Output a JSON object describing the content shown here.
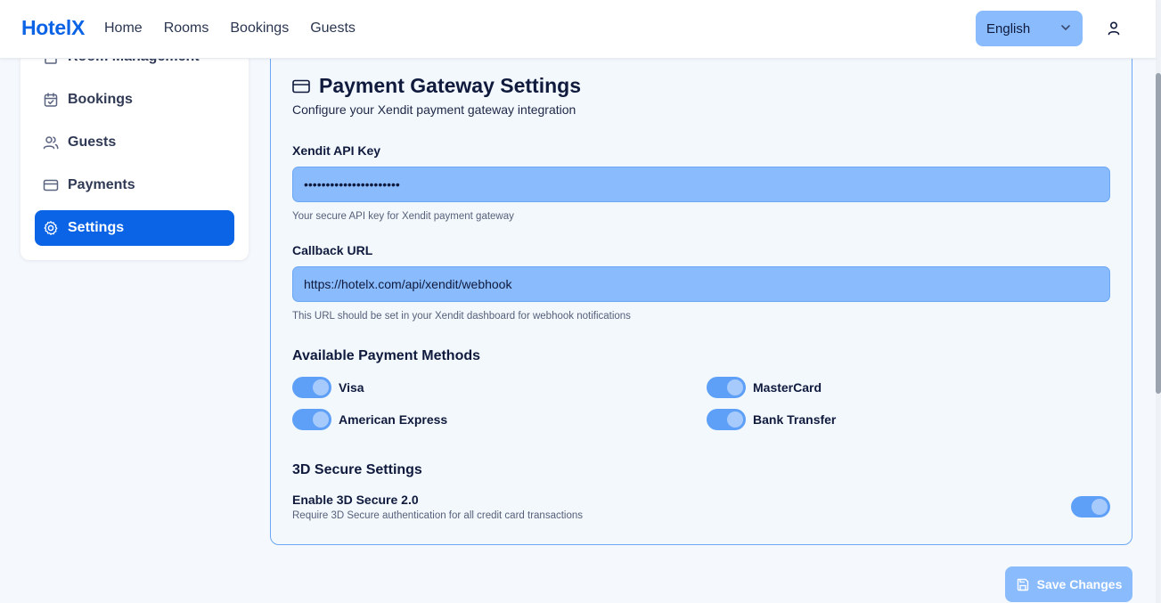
{
  "header": {
    "brand": "HotelX",
    "nav": [
      "Home",
      "Rooms",
      "Bookings",
      "Guests"
    ],
    "language": "English",
    "user_icon": "user-icon"
  },
  "sidebar": {
    "items": [
      {
        "label": "Room Management",
        "icon": "building-icon"
      },
      {
        "label": "Bookings",
        "icon": "calendar-check-icon"
      },
      {
        "label": "Guests",
        "icon": "users-icon"
      },
      {
        "label": "Payments",
        "icon": "credit-card-icon"
      },
      {
        "label": "Settings",
        "icon": "gear-icon",
        "active": true
      }
    ]
  },
  "settings": {
    "title": "Payment Gateway Settings",
    "subtitle": "Configure your Xendit payment gateway integration",
    "api_key": {
      "label": "Xendit API Key",
      "value": "••••••••••••••••••••••",
      "help": "Your secure API key for Xendit payment gateway"
    },
    "callback": {
      "label": "Callback URL",
      "value": "https://hotelx.com/api/xendit/webhook",
      "help": "This URL should be set in your Xendit dashboard for webhook notifications"
    },
    "methods_title": "Available Payment Methods",
    "methods": [
      {
        "label": "Visa",
        "enabled": true
      },
      {
        "label": "MasterCard",
        "enabled": true
      },
      {
        "label": "American Express",
        "enabled": true
      },
      {
        "label": "Bank Transfer",
        "enabled": true
      }
    ],
    "secure_title": "3D Secure Settings",
    "secure": {
      "label": "Enable 3D Secure 2.0",
      "help": "Require 3D Secure authentication for all credit card transactions",
      "enabled": true
    },
    "save_label": "Save Changes"
  },
  "colors": {
    "brand": "#0b63e5",
    "input_bg": "#89bbfd",
    "toggle_on": "#5ea0f8",
    "card_border": "#6aa7f5"
  }
}
